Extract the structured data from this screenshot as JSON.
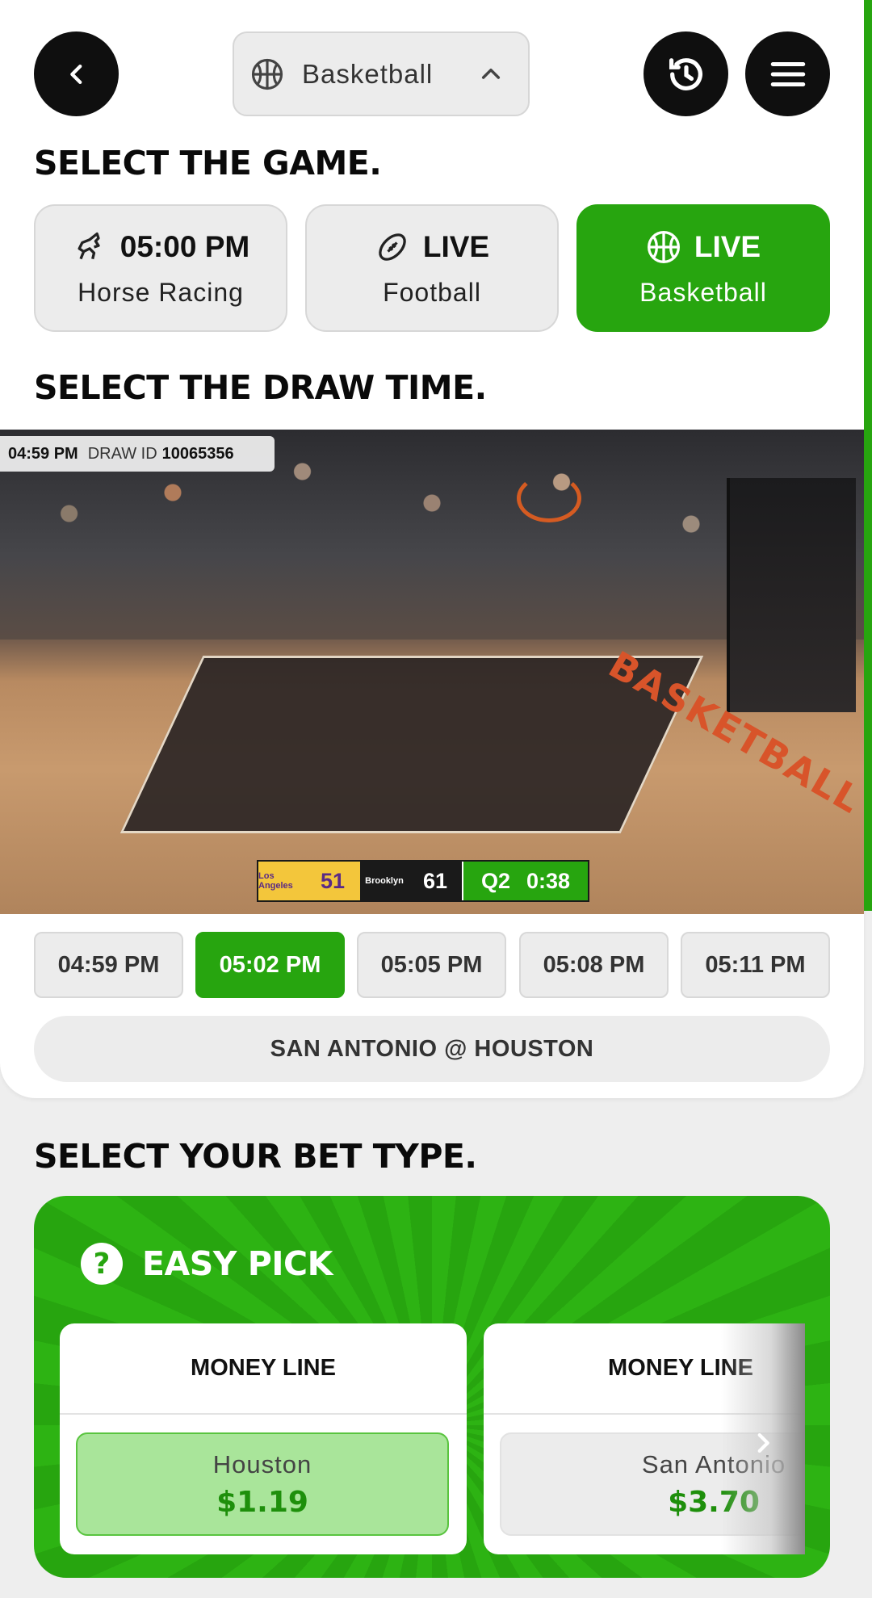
{
  "header": {
    "sport_selector": {
      "label": "Basketball",
      "icon": "basketball-icon",
      "chevron": "chevron-up-icon"
    },
    "back_icon": "chevron-left-icon",
    "history_icon": "history-icon",
    "menu_icon": "hamburger-menu-icon"
  },
  "select_game": {
    "title": "SELECT THE GAME.",
    "games": [
      {
        "time": "05:00 PM",
        "name": "Horse Racing",
        "icon": "horse-icon",
        "active": false
      },
      {
        "time": "LIVE",
        "name": "Football",
        "icon": "football-icon",
        "active": false
      },
      {
        "time": "LIVE",
        "name": "Basketball",
        "icon": "basketball-icon",
        "active": true
      }
    ]
  },
  "draw_time": {
    "title": "SELECT THE DRAW TIME.",
    "video": {
      "overlay_time": "04:59 PM",
      "draw_id_label": "DRAW ID",
      "draw_id": "10065356",
      "court_text": "BASKETBALL",
      "scoreboard": {
        "home_abbr": "Los Angeles",
        "home_score": "51",
        "away_abbr": "Brooklyn",
        "away_score": "61",
        "quarter": "Q2",
        "clock": "0:38"
      }
    },
    "times": [
      "04:59 PM",
      "05:02 PM",
      "05:05 PM",
      "05:08 PM",
      "05:11 PM"
    ],
    "selected_index": 1,
    "matchup": "SAN ANTONIO @ HOUSTON"
  },
  "bet_type": {
    "title": "SELECT YOUR BET TYPE.",
    "easy_pick_label": "EASY PICK",
    "help_symbol": "?",
    "cards": [
      {
        "header": "MONEY LINE",
        "team": "Houston",
        "price": "$1.19",
        "selected": true
      },
      {
        "header": "MONEY LINE",
        "team": "San Antonio",
        "price": "$3.70",
        "selected": false
      }
    ]
  },
  "colors": {
    "accent_green": "#27a50f",
    "dark": "#0f0f0f",
    "chip_grey": "#ececec"
  }
}
